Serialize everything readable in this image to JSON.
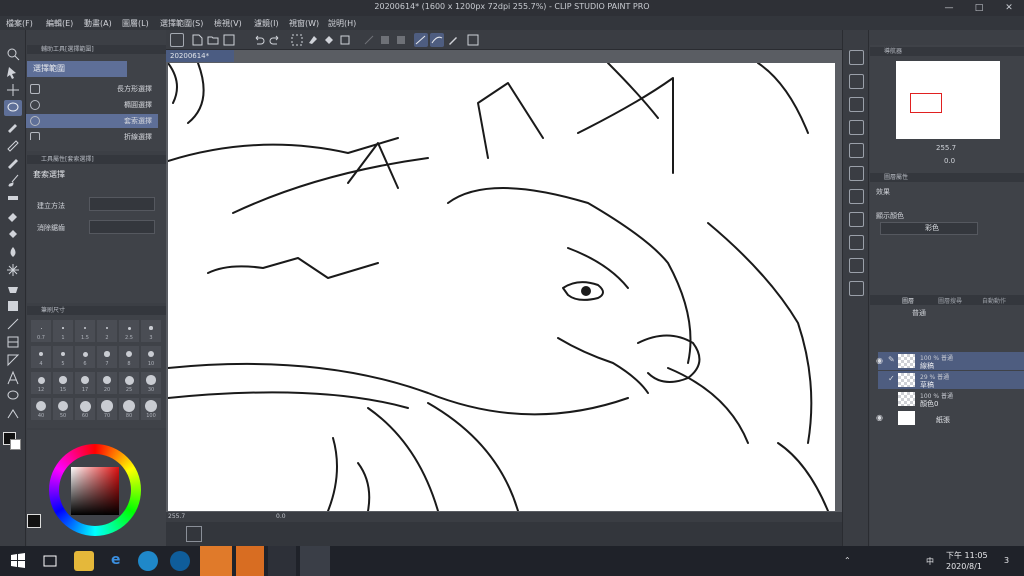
{
  "app": {
    "window_title": "20200614* (1600 x 1200px 72dpi 255.7%)  - CLIP STUDIO PAINT PRO",
    "doc_tab": "20200614*"
  },
  "menu": [
    "檔案(F)",
    "編輯(E)",
    "動畫(A)",
    "圖層(L)",
    "選擇範圍(S)",
    "檢視(V)",
    "濾鏡(I)",
    "視窗(W)",
    "說明(H)"
  ],
  "subtool_panel": {
    "header": "輔助工具[選擇範圍]",
    "group_title": "選擇範圍",
    "items": [
      {
        "label": "長方形選擇",
        "selected": false
      },
      {
        "label": "橢圓選擇",
        "selected": false
      },
      {
        "label": "套索選擇",
        "selected": true
      },
      {
        "label": "折線選擇",
        "selected": false
      }
    ]
  },
  "tool_property": {
    "header": "工具屬性[套索選擇]",
    "title": "套索選擇",
    "create_method_label": "建立方法",
    "antialias_label": "消除鋸齒"
  },
  "brush_size": {
    "header": "筆刷尺寸",
    "sizes": [
      "0.7",
      "1",
      "1.5",
      "2",
      "2.5",
      "3",
      "4",
      "5",
      "6",
      "7",
      "8",
      "10",
      "12",
      "15",
      "17",
      "20",
      "25",
      "30",
      "40",
      "50",
      "60",
      "70",
      "80",
      "100"
    ]
  },
  "navigator": {
    "header": "導航器",
    "zoom": "255.7",
    "rotation": "0.0"
  },
  "layer_property": {
    "header": "圖層屬性",
    "effect_label": "效果",
    "display_color_label": "顯示顏色",
    "display_color_value": "彩色"
  },
  "layers_panel": {
    "tabs": [
      "圖層",
      "圖層搜尋",
      "自動動作"
    ],
    "blend_mode": "普通",
    "layers": [
      {
        "opacity_mode": "100 % 普通",
        "name": "線稿",
        "selected": true,
        "visible": true,
        "editing": true
      },
      {
        "opacity_mode": "29 % 普通",
        "name": "草稿",
        "selected": true,
        "visible": false,
        "editing": false
      },
      {
        "opacity_mode": "100 % 普通",
        "name": "顏色0",
        "selected": false,
        "visible": false,
        "editing": false
      },
      {
        "opacity_mode": "",
        "name": "紙張",
        "selected": false,
        "visible": true,
        "editing": false
      }
    ]
  },
  "canvas_status": {
    "zoom": "255.7",
    "rotation": "0.0"
  },
  "taskbar": {
    "time": "下午 11:05",
    "date": "2020/8/1",
    "ime": "中",
    "notifications": "3"
  },
  "colors": {
    "accent": "#5e6f98",
    "panel": "#3f4248",
    "taskbar": "#1f2229",
    "active_app": "#e07a2a"
  }
}
